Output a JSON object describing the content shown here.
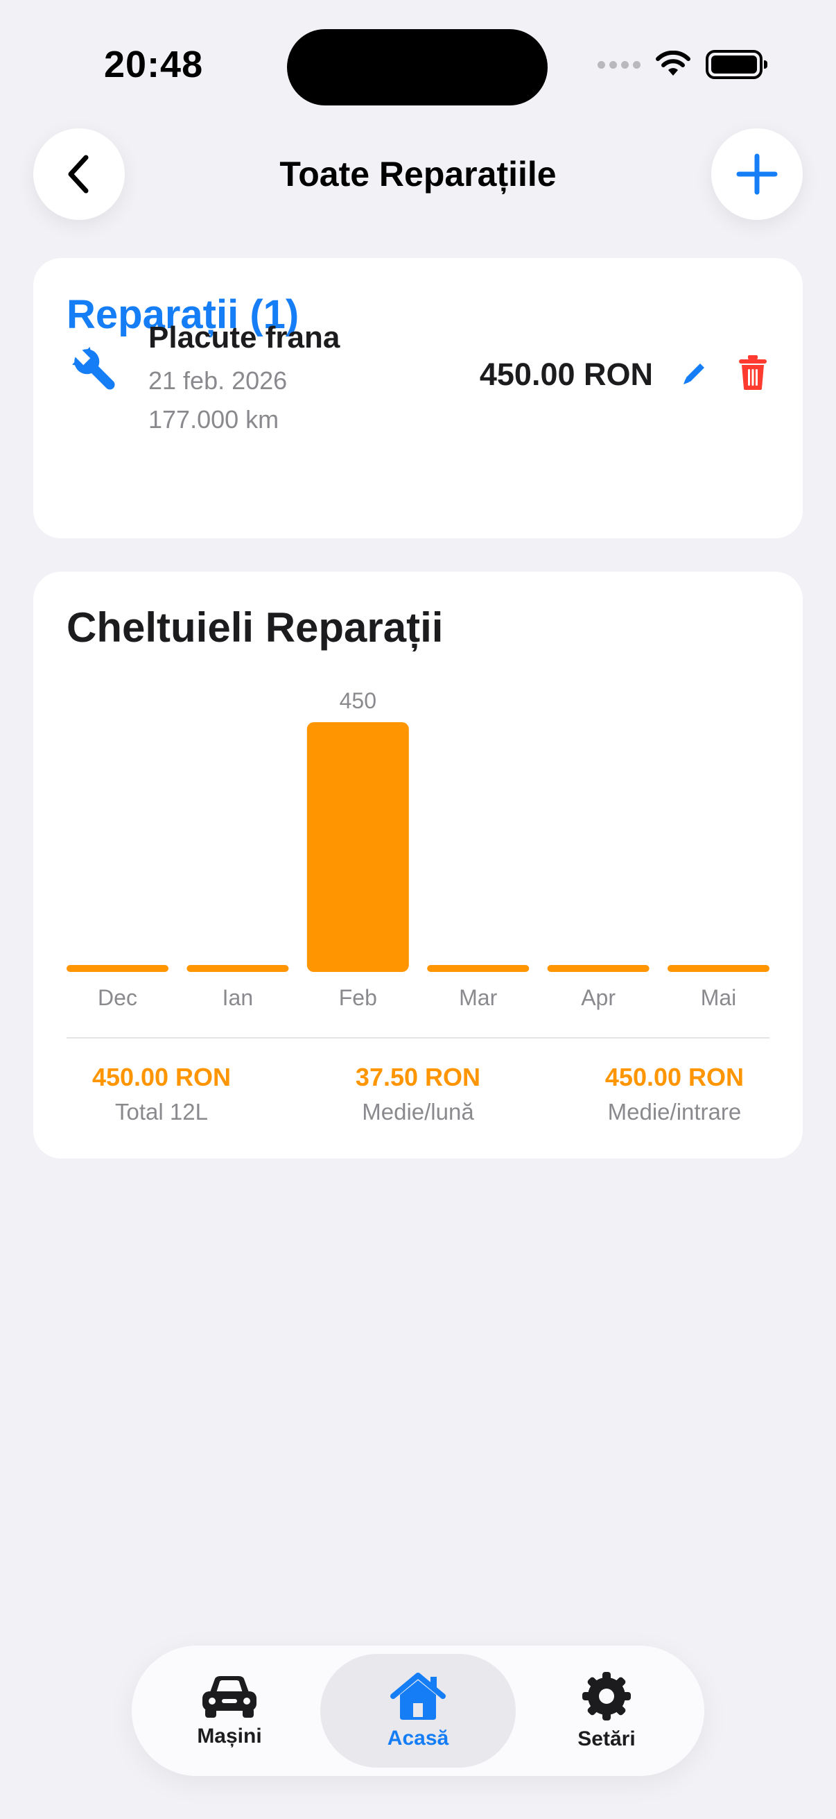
{
  "status_bar": {
    "time": "20:48"
  },
  "nav": {
    "title": "Toate Reparațiile"
  },
  "repairs": {
    "title": "Reparații (1)",
    "items": [
      {
        "name": "Placute frana",
        "date": "21 feb. 2026",
        "km": "177.000 km",
        "price": "450.00 RON"
      }
    ]
  },
  "chart_data": {
    "type": "bar",
    "title": "Cheltuieli Reparații",
    "categories": [
      "Dec",
      "Ian",
      "Feb",
      "Mar",
      "Apr",
      "Mai"
    ],
    "values": [
      0,
      0,
      450,
      0,
      0,
      0
    ],
    "value_labels": [
      "",
      "",
      "450",
      "",
      "",
      ""
    ],
    "ylim": [
      0,
      450
    ],
    "grid": false,
    "color": "#ff9500"
  },
  "stats": [
    {
      "value": "450.00 RON",
      "label": "Total 12L"
    },
    {
      "value": "37.50 RON",
      "label": "Medie/lună"
    },
    {
      "value": "450.00 RON",
      "label": "Medie/intrare"
    }
  ],
  "tabbar": {
    "active": "Acasă",
    "items": [
      {
        "label": "Mașini",
        "icon": "car-icon"
      },
      {
        "label": "Acasă",
        "icon": "house-icon"
      },
      {
        "label": "Setări",
        "icon": "gear-icon"
      }
    ]
  },
  "colors": {
    "accent": "#157ef6",
    "chart": "#ff9500",
    "danger": "#ff3b30",
    "background": "#f2f1f6"
  }
}
